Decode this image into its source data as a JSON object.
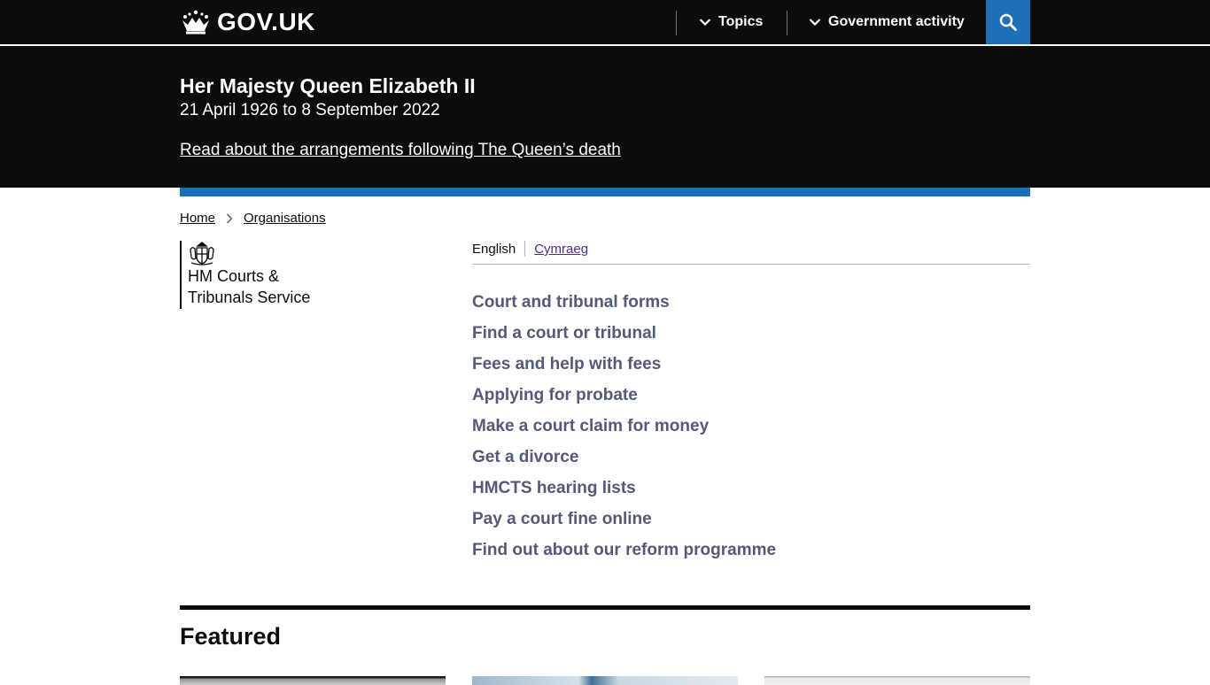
{
  "header": {
    "logo_text": "GOV.UK",
    "nav": [
      {
        "label": "Topics"
      },
      {
        "label": "Government activity"
      }
    ],
    "search_label": "Search GOV.UK"
  },
  "banner": {
    "title": "Her Majesty Queen Elizabeth II",
    "dates": "21 April 1926 to 8 September 2022",
    "link": "Read about the arrangements following The Queen’s death"
  },
  "breadcrumb": {
    "items": [
      "Home",
      "Organisations"
    ]
  },
  "organisation": {
    "name": "HM Courts &\nTribunals Service"
  },
  "language": {
    "current": "English",
    "other": "Cymraeg"
  },
  "links": [
    "Court and tribunal forms",
    "Find a court or tribunal",
    "Fees and help with fees",
    "Applying for probate",
    "Make a court claim for money",
    "Get a divorce",
    "HMCTS hearing lists",
    "Pay a court fine online",
    "Find out about our reform programme"
  ],
  "featured": {
    "title": "Featured"
  },
  "colors": {
    "header_bg": "#0b0c0c",
    "accent_blue": "#1d70b8",
    "link_text": "#535977",
    "visited_link": "#4c2c92"
  },
  "icons": [
    "crown-icon",
    "chevron-down-icon",
    "search-icon",
    "chevron-right-icon",
    "royal-crest-icon"
  ]
}
